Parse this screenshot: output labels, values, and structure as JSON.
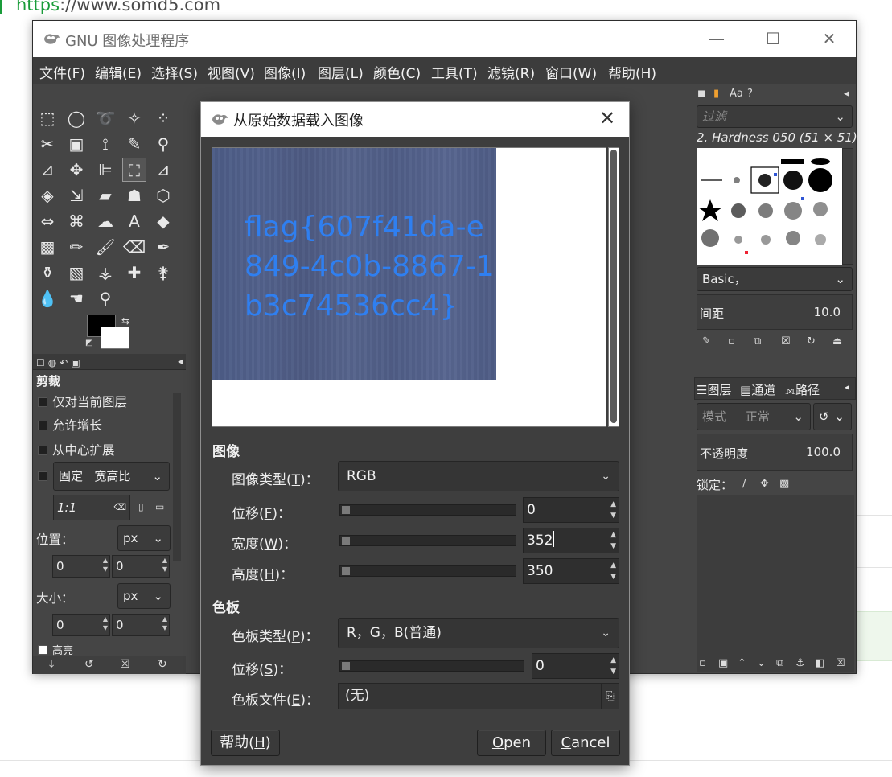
{
  "browser": {
    "url_protocol": "https",
    "url_rest": "://www.somd5.com"
  },
  "gimp": {
    "title": "GNU 图像处理程序",
    "menu": [
      "文件(F)",
      "编辑(E)",
      "选择(S)",
      "视图(V)",
      "图像(I)",
      "图层(L)",
      "颜色(C)",
      "工具(T)",
      "滤镜(R)",
      "窗口(W)",
      "帮助(H)"
    ],
    "tool_options": {
      "title": "剪裁",
      "current_layer_only": "仅对当前图层",
      "allow_growing": "允许增长",
      "expand_from_center": "从中心扩展",
      "fixed_label": "固定",
      "fixed_value": "宽高比",
      "ratio": "1:1",
      "position_label": "位置：",
      "position_unit": "px",
      "position_x": "0",
      "position_y": "0",
      "size_label": "大小：",
      "size_unit": "px",
      "size_x": "0",
      "size_y": "0",
      "highlight_label": "高亮"
    },
    "brushes": {
      "filter_placeholder": "过滤",
      "brush_name": "2. Hardness 050 (51 × 51)",
      "preset": "Basic，",
      "spacing_label": "间距",
      "spacing_value": "10.0"
    },
    "layers": {
      "tab_layers": "图层",
      "tab_channels": "通道",
      "tab_paths": "路径",
      "mode_label": "模式",
      "mode_value": "正常",
      "opacity_label": "不透明度",
      "opacity_value": "100.0",
      "lock_label": "锁定："
    }
  },
  "dialog": {
    "title": "从原始数据载入图像",
    "preview_text": "flag{607f41da-e849-4c0b-8867-1b3c74536cc4}",
    "image_section": "图像",
    "image_type_label": "图像类型(",
    "image_type_key": "T",
    "image_type_value": "RGB",
    "offset_label": "位移(",
    "offset_key": "F",
    "offset_value": "0",
    "width_label": "宽度(",
    "width_key": "W",
    "width_value": "352",
    "height_label": "高度(",
    "height_key": "H",
    "height_value": "350",
    "palette_section": "色板",
    "palette_type_label": "色板类型(",
    "palette_type_key": "P",
    "palette_type_value": "R，G，B(普通)",
    "palette_offset_label": "位移(",
    "palette_offset_key": "S",
    "palette_offset_value": "0",
    "palette_file_label": "色板文件(",
    "palette_file_key": "E",
    "palette_file_value": "(无)",
    "label_suffix": ")：",
    "help_label": "帮助(",
    "help_key": "H",
    "help_suffix": ")",
    "open_key": "O",
    "open_rest": "pen",
    "cancel_key": "C",
    "cancel_rest": "ancel"
  }
}
